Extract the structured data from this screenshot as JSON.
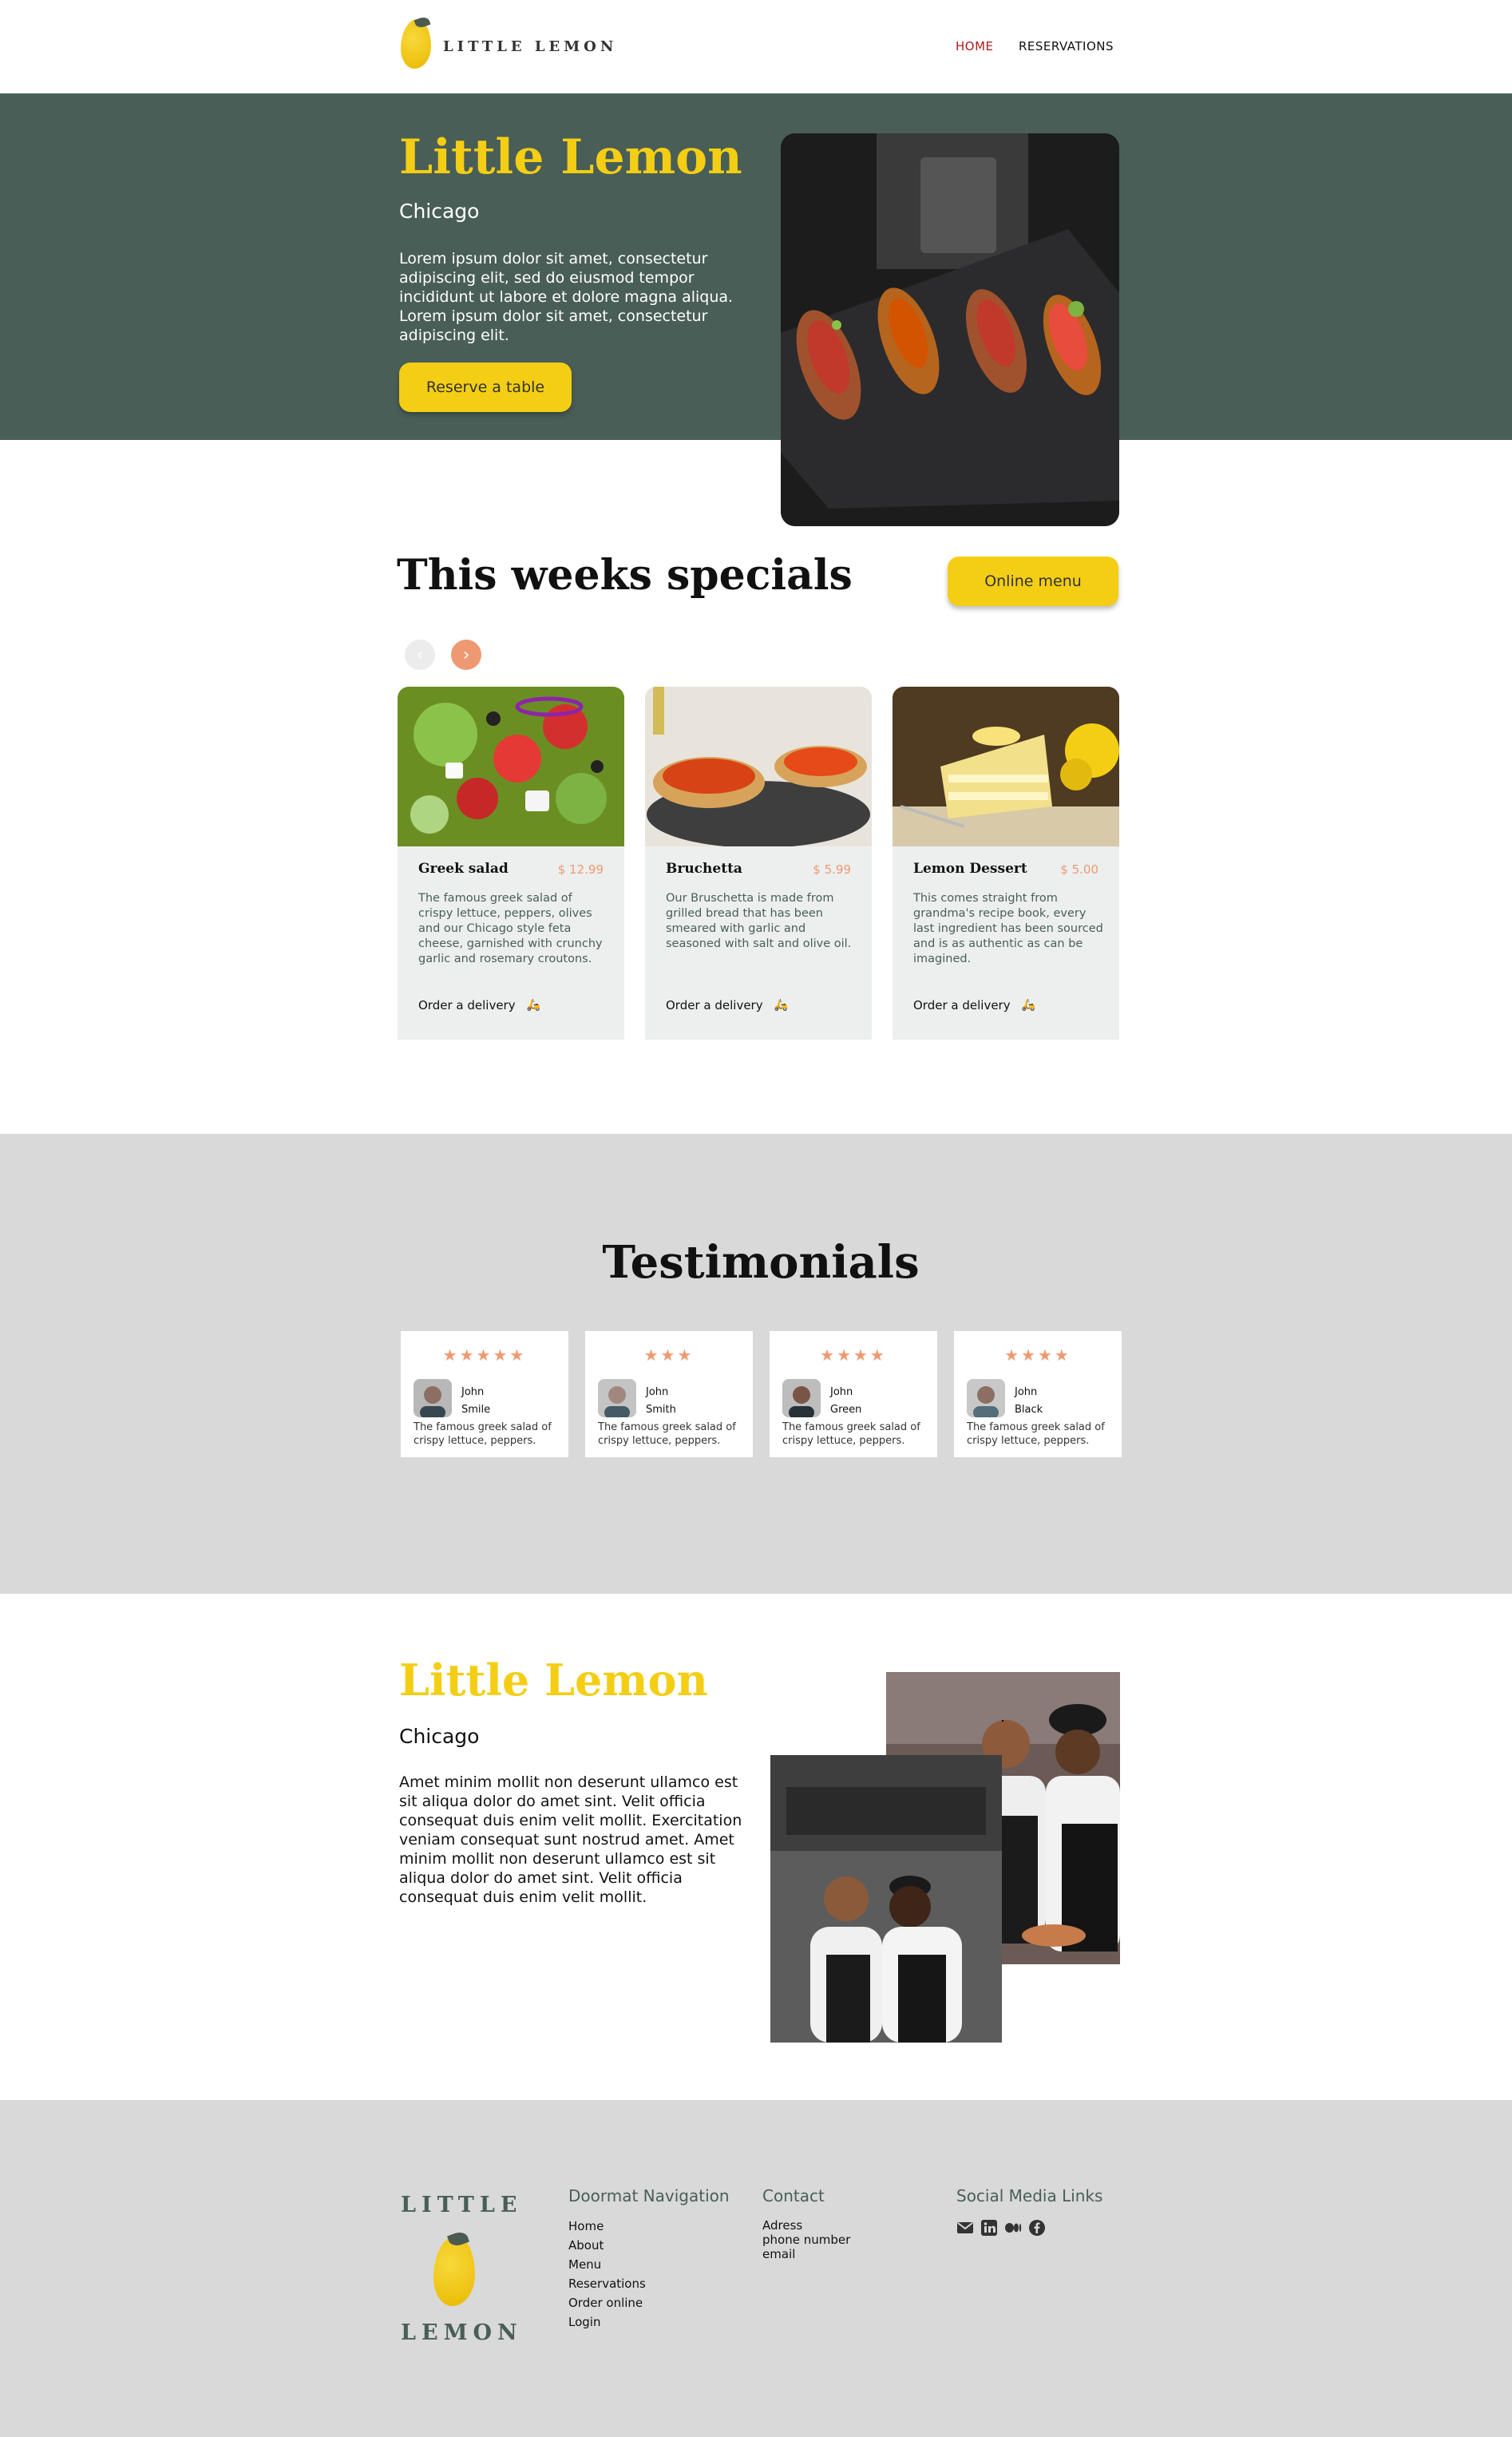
{
  "header": {
    "logo_text": "LITTLE LEMON",
    "nav": [
      {
        "label": "HOME",
        "active": true
      },
      {
        "label": "RESERVATIONS",
        "active": false
      }
    ]
  },
  "hero": {
    "title": "Little Lemon",
    "city": "Chicago",
    "text": "Lorem ipsum dolor sit amet, consectetur adipiscing elit, sed do eiusmod tempor incididunt ut labore et dolore magna aliqua. Lorem ipsum dolor sit amet, consectetur adipiscing elit.",
    "button": "Reserve a table"
  },
  "specials": {
    "title": "This weeks specials",
    "menu_button": "Online menu",
    "cards": [
      {
        "name": "Greek salad",
        "price": "$ 12.99",
        "desc": "The famous greek salad of crispy lettuce, peppers, olives and our Chicago style feta cheese, garnished with crunchy garlic and rosemary croutons.",
        "order": "Order a delivery"
      },
      {
        "name": "Bruchetta",
        "price": "$ 5.99",
        "desc": "Our Bruschetta is made from grilled bread that has been smeared with garlic and seasoned with salt and olive oil.",
        "order": "Order a delivery"
      },
      {
        "name": "Lemon Dessert",
        "price": "$ 5.00",
        "desc": "This comes straight from grandma's recipe book, every last ingredient has been sourced and is as authentic as can be imagined.",
        "order": "Order a delivery"
      }
    ]
  },
  "testimonials": {
    "title": "Testimonials",
    "items": [
      {
        "stars": "★★★★★",
        "first": "John",
        "last": "Smile",
        "quote": "The famous greek salad of crispy lettuce, peppers."
      },
      {
        "stars": "★★★",
        "first": "John",
        "last": "Smith",
        "quote": "The famous greek salad of crispy lettuce, peppers."
      },
      {
        "stars": "★★★★",
        "first": "John",
        "last": "Green",
        "quote": "The famous greek salad of crispy lettuce, peppers."
      },
      {
        "stars": "★★★★",
        "first": "John",
        "last": "Black",
        "quote": "The famous greek salad of crispy lettuce, peppers."
      }
    ]
  },
  "about": {
    "title": "Little Lemon",
    "city": "Chicago",
    "text": "Amet minim mollit non deserunt ullamco est sit aliqua dolor do amet sint. Velit officia consequat duis enim velit mollit. Exercitation veniam consequat sunt nostrud amet. Amet minim mollit non deserunt ullamco est sit aliqua dolor do amet sint. Velit officia consequat duis enim velit mollit."
  },
  "footer": {
    "logo_top": "LITTLE",
    "logo_bottom": "LEMON",
    "nav_heading": "Doormat Navigation",
    "nav_links": [
      "Home",
      "About",
      "Menu",
      "Reservations",
      "Order online",
      "Login"
    ],
    "contact_heading": "Contact",
    "contact_lines": [
      "Adress",
      "phone number",
      "email"
    ],
    "social_heading": "Social Media Links",
    "social_icons": [
      "envelope-icon",
      "linkedin-icon",
      "medium-icon",
      "facebook-icon"
    ]
  },
  "colors": {
    "primary_green": "#495e57",
    "primary_yellow": "#f4ce14",
    "accent_salmon": "#ee9972",
    "nav_active": "#b01b1b",
    "section_gray": "#d9d9d9",
    "card_bg": "#edefee"
  }
}
